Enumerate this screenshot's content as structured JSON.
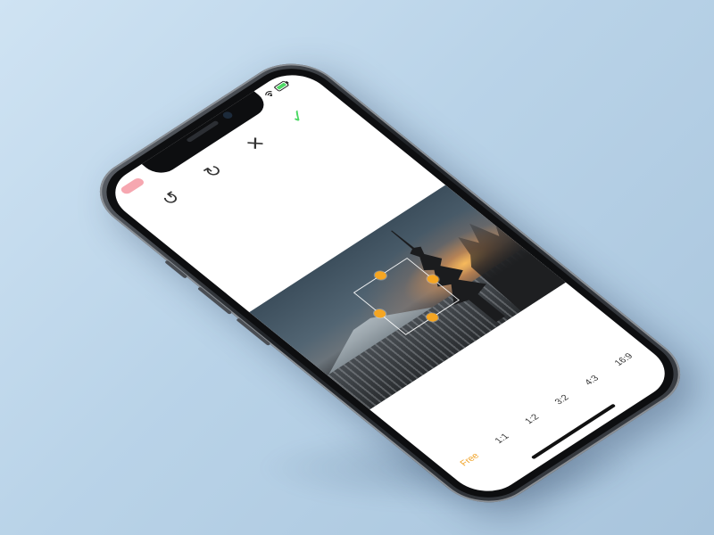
{
  "status_bar": {
    "time": "",
    "icons": [
      "wifi-icon",
      "battery-icon"
    ]
  },
  "toolbar": {
    "buttons": [
      {
        "name": "rotate-left-icon",
        "glyph": "↺"
      },
      {
        "name": "rotate-right-icon",
        "glyph": "↻"
      },
      {
        "name": "close-icon",
        "glyph": "✕"
      },
      {
        "name": "checkmark-icon",
        "glyph": "✓"
      }
    ]
  },
  "editor": {
    "image_subject": "pagoda at sunset"
  },
  "ratios": {
    "items": [
      "Free",
      "1:1",
      "1:2",
      "3:2",
      "4:3",
      "16:9"
    ],
    "selected": "Free"
  },
  "colors": {
    "accent": "#f5a623",
    "confirm": "#4cd964",
    "record_pill": "#f6a7b0"
  }
}
